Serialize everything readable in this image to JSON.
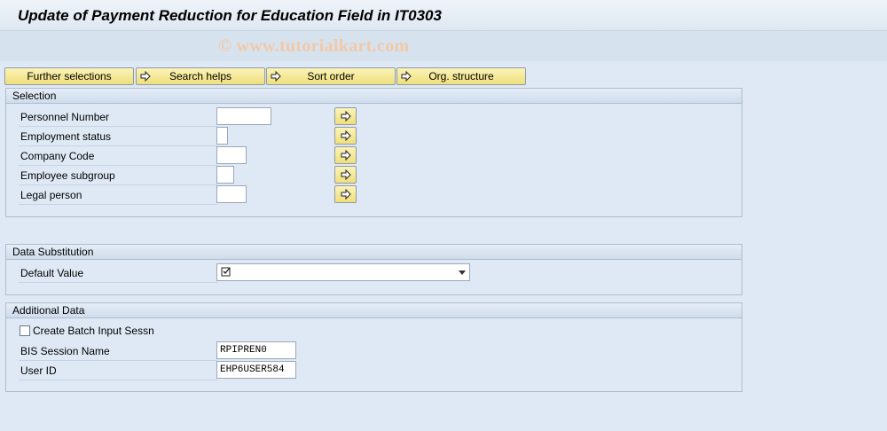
{
  "window": {
    "title": "Update of Payment Reduction for Education Field in IT0303"
  },
  "watermark": "© www.tutorialkart.com",
  "toolbar": {
    "further_selections": "Further selections",
    "search_helps": "Search helps",
    "sort_order": "Sort order",
    "org_structure": "Org. structure"
  },
  "selection": {
    "header": "Selection",
    "fields": [
      {
        "label": "Personnel Number",
        "value": ""
      },
      {
        "label": "Employment status",
        "value": ""
      },
      {
        "label": "Company Code",
        "value": ""
      },
      {
        "label": "Employee subgroup",
        "value": ""
      },
      {
        "label": "Legal person",
        "value": ""
      }
    ]
  },
  "data_substitution": {
    "header": "Data Substitution",
    "default_value_label": "Default Value",
    "default_value_icon": "checkbox-checked-icon"
  },
  "additional_data": {
    "header": "Additional Data",
    "create_batch_label": "Create Batch Input Sessn",
    "create_batch_checked": false,
    "bis_session_label": "BIS Session Name",
    "bis_session_value": "RPIPREN0",
    "user_id_label": "User ID",
    "user_id_value": "EHP6USER584"
  },
  "colors": {
    "background": "#dfe9f5",
    "button": "#f5e99a",
    "watermark": "#f1c9a6"
  }
}
